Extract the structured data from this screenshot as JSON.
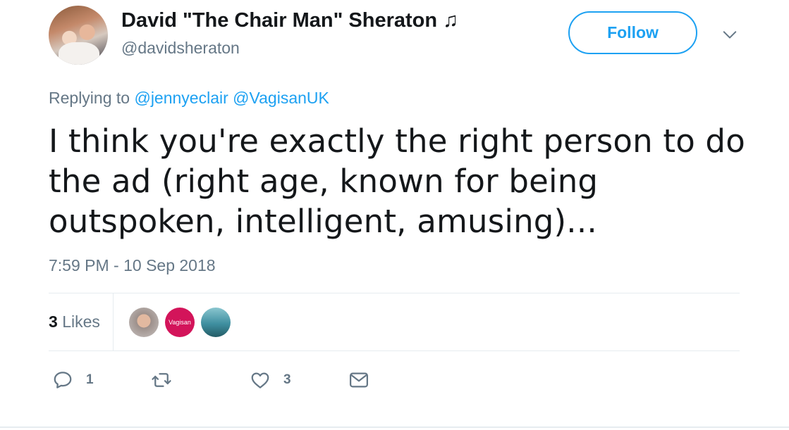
{
  "author": {
    "display_name": "David \"The Chair Man\" Sheraton ♫",
    "handle": "@davidsheraton"
  },
  "follow_button": {
    "label": "Follow"
  },
  "reply": {
    "prefix": "Replying to",
    "mentions": [
      "@jennyeclair",
      "@VagisanUK"
    ]
  },
  "tweet": {
    "text": "I think you're exactly the right person to do the ad (right age, known for being outspoken, intelligent, amusing)...",
    "timestamp": "7:59 PM - 10 Sep 2018"
  },
  "stats": {
    "likes_count": "3",
    "likes_label": "Likes",
    "likers": [
      {
        "name": "liker-avatar"
      },
      {
        "name": "liker-avatar",
        "label": "Vagisan"
      },
      {
        "name": "liker-avatar"
      }
    ]
  },
  "actions": {
    "reply_count": "1",
    "retweet_count": "",
    "like_count": "3"
  },
  "colors": {
    "accent": "#1da1f2",
    "muted": "#657786",
    "text": "#14171a",
    "divider": "#e6ecf0",
    "vagisan": "#d3145a"
  },
  "icons": [
    "chevron-down-icon",
    "reply-icon",
    "retweet-icon",
    "heart-icon",
    "message-icon"
  ]
}
